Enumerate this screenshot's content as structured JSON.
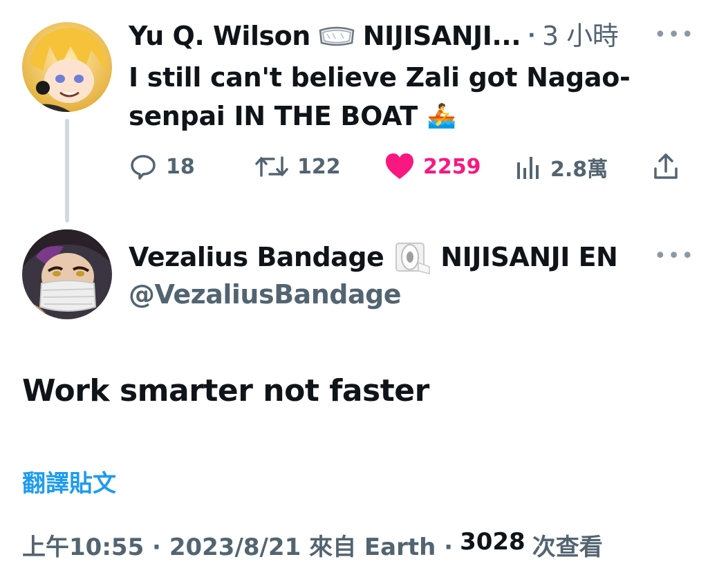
{
  "parent_tweet": {
    "author_name": "Yu Q. Wilson",
    "author_org": "NIJISANJI...",
    "time": "3 小時",
    "text_line1": "I still can't believe Zali got Nagao-",
    "text_line2": "senpai IN THE BOAT",
    "emoji": "🚣",
    "replies": "18",
    "retweets": "122",
    "likes": "2259",
    "views": "2.8萬"
  },
  "main_tweet": {
    "author_name": "Vezalius Bandage",
    "author_org": "NIJISANJI EN",
    "handle": "@VezaliusBandage",
    "text": "Work smarter not faster",
    "translate_label": "翻譯貼文",
    "timestamp": "上午10:55 · 2023/8/21 來自 Earth ·",
    "view_count": "3028",
    "view_label": "次查看"
  },
  "icons": {
    "goggles": "goggles-icon",
    "toilet_paper": "toilet-paper-icon",
    "more": "more-icon",
    "reply": "reply-icon",
    "retweet": "retweet-icon",
    "like": "heart-icon",
    "views": "views-icon",
    "share": "share-icon"
  },
  "colors": {
    "like": "#f91880",
    "link": "#1d9bf0",
    "muted": "#536471",
    "thread_line": "#cfd9de"
  }
}
